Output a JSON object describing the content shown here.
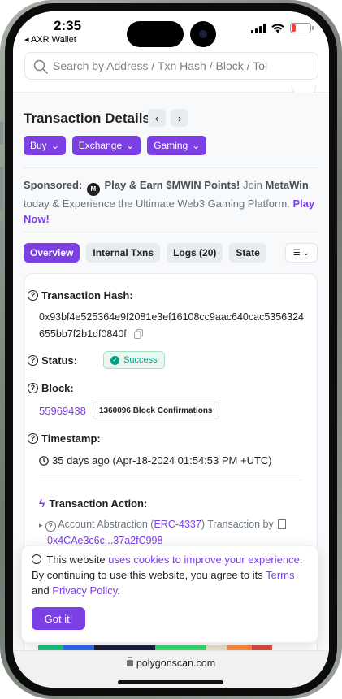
{
  "status_bar": {
    "time": "2:35",
    "back_app": "◂ AXR Wallet"
  },
  "search": {
    "placeholder": "Search by Address / Txn Hash / Block / Tol"
  },
  "header": {
    "title": "Transaction Details",
    "prev_icon": "chevron-left-icon",
    "next_icon": "chevron-right-icon"
  },
  "nav_pills": [
    {
      "label": "Buy"
    },
    {
      "label": "Exchange"
    },
    {
      "label": "Gaming"
    }
  ],
  "sponsored": {
    "prefix": "Sponsored:",
    "headline": "Play & Earn $MWIN Points!",
    "join": "Join",
    "brand": "MetaWin",
    "body": "today & Experience the Ultimate Web3 Gaming Platform.",
    "cta": "Play Now!"
  },
  "tabs": [
    {
      "label": "Overview",
      "active": true
    },
    {
      "label": "Internal Txns",
      "active": false
    },
    {
      "label": "Logs (20)",
      "active": false
    },
    {
      "label": "State",
      "active": false
    }
  ],
  "details": {
    "hash_label": "Transaction Hash:",
    "hash_value": "0x93bf4e525364e9f2081e3ef16108cc9aac640cac5356324655bb7f2b1df0840f",
    "status_label": "Status:",
    "status_value": "Success",
    "block_label": "Block:",
    "block_number": "55969438",
    "block_confirmations": "1360096 Block Confirmations",
    "timestamp_label": "Timestamp:",
    "timestamp_value": "35 days ago (Apr-18-2024 01:54:53 PM +UTC)",
    "action_label": "Transaction Action:",
    "action_prefix": "Account Abstraction (",
    "action_erc": "ERC-4337",
    "action_mid": ") Transaction by",
    "action_address": "0x4CAe3c6c...37a2fC998"
  },
  "cookie": {
    "prefix": "This website",
    "link1": "uses cookies to improve your experience",
    "mid": ". By continuing to use this website, you agree to its",
    "terms": "Terms",
    "and": "and",
    "privacy": "Privacy Policy",
    "end": ".",
    "button": "Got it!"
  },
  "browser": {
    "url": "polygonscan.com"
  },
  "colors": {
    "accent": "#7b3fe4",
    "success": "#00a186",
    "battery": "#ff3b30"
  }
}
